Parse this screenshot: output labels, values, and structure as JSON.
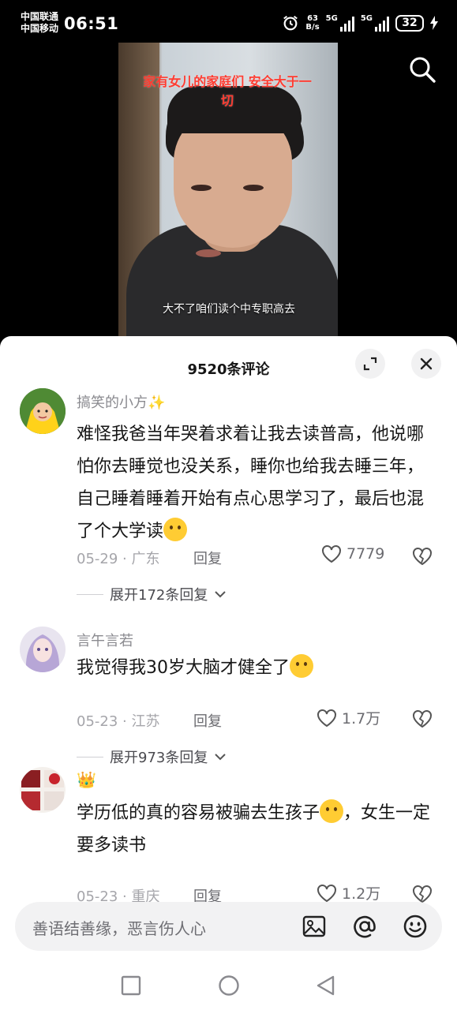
{
  "status_bar": {
    "carrier_1": "中国联通",
    "carrier_2": "中国移动",
    "time": "06:51",
    "speed_value": "63",
    "speed_unit": "B/s",
    "net_1": "5G",
    "net_2": "5G",
    "battery": "32",
    "icons": [
      "alarm-icon",
      "signal-icon",
      "charging-icon"
    ]
  },
  "video": {
    "title": "家有女儿的家庭们 安全大于一切",
    "subtitle": "大不了咱们读个中专职高去",
    "search_icon": "search-icon"
  },
  "comments_panel": {
    "title": "9520条评论",
    "expand_icon": "expand-icon",
    "close_icon": "close-icon"
  },
  "comments": [
    {
      "username": "搞笑的小方",
      "username_suffix": "✨",
      "text": "难怪我爸当年哭着求着让我去读普高，他说哪怕你去睡觉也没关系，睡你也给我去睡三年，自己睡着睡着开始有点心思学习了，最后也混了个大学读",
      "emoji": "laughing-tears-emoji",
      "date": "05-29",
      "location": "广东",
      "reply_label": "回复",
      "likes": "7779",
      "expand_label": "展开172条回复"
    },
    {
      "username": "言午言若",
      "text": "我觉得我30岁大脑才健全了",
      "emoji": "sweat-smile-emoji",
      "date": "05-23",
      "location": "江苏",
      "reply_label": "回复",
      "likes": "1.7万",
      "expand_label": "展开973条回复"
    },
    {
      "username": "👑",
      "text_1": "学历低的真的容易被骗去生孩子",
      "text_2": "，女生一定要多读书",
      "emoji": "blush-emoji",
      "date": "05-23",
      "location": "重庆",
      "reply_label": "回复",
      "likes": "1.2万"
    }
  ],
  "separator": " · ",
  "input_bar": {
    "placeholder": "善语结善缘，恶言伤人心",
    "icons": [
      "image-icon",
      "mention-icon",
      "emoji-icon"
    ]
  },
  "nav_bar": {
    "icons": [
      "recents-icon",
      "home-icon",
      "back-icon"
    ]
  },
  "colors": {
    "accent_red": "#ff3b30",
    "text_primary": "#161616",
    "text_secondary": "#8a8a8f",
    "sheet_bg": "#ffffff",
    "input_bg": "#f2f2f3"
  }
}
